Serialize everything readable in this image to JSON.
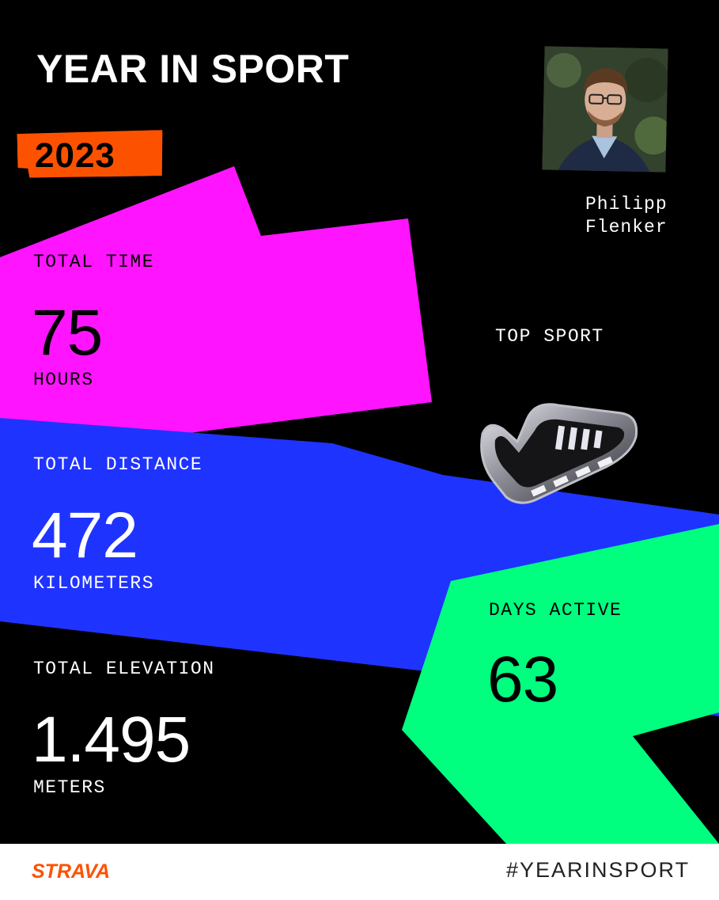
{
  "header": {
    "title": "YEAR IN SPORT",
    "year": "2023"
  },
  "athlete": {
    "name_line1": "Philipp",
    "name_line2": "Flenker"
  },
  "stats": {
    "total_time": {
      "label": "TOTAL TIME",
      "value": "75",
      "unit": "HOURS"
    },
    "total_distance": {
      "label": "TOTAL DISTANCE",
      "value": "472",
      "unit": "KILOMETERS"
    },
    "total_elevation": {
      "label": "TOTAL ELEVATION",
      "value": "1.495",
      "unit": "METERS"
    },
    "days_active": {
      "label": "DAYS ACTIVE",
      "value": "63"
    },
    "top_sport": {
      "label": "TOP SPORT",
      "icon": "running-shoe-icon"
    }
  },
  "footer": {
    "brand": "STRAVA",
    "hashtag": "#YEARINSPORT"
  },
  "colors": {
    "background": "#000000",
    "magenta": "#ff14ff",
    "blue": "#1f33ff",
    "green": "#00ff7f",
    "orange": "#fc5200"
  }
}
